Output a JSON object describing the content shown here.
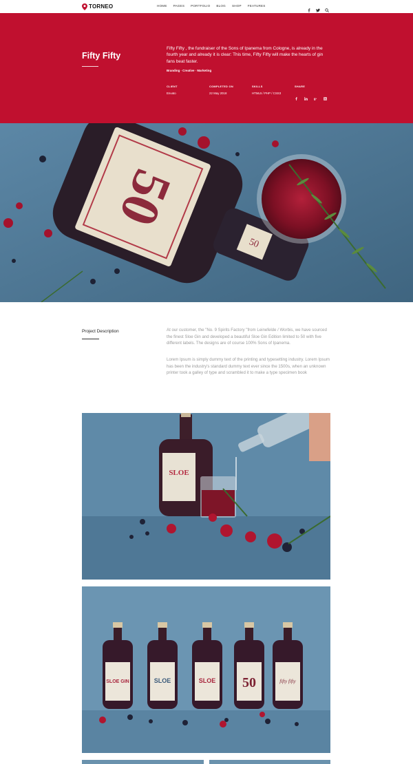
{
  "brand": {
    "name": "TORNEO",
    "accent": "#c0102f"
  },
  "nav": {
    "items": [
      "HOME",
      "PAGES",
      "PORTFOLIO",
      "BLOG",
      "SHOP",
      "FEATURES"
    ]
  },
  "header_social": [
    "facebook-icon",
    "twitter-icon",
    "search-icon"
  ],
  "hero": {
    "title": "Fifty Fifty",
    "description": "Fifty Fifty , the fundraiser of the Sons of Ipanema from Cologne, is already in the fourth year and already it is clear: This time, Fifty Fifty will make the hearts of gin fans beat faster.",
    "tags": "Branding · Creative · Marketing",
    "meta": {
      "client_label": "CLIENT",
      "client_value": "Envato",
      "completed_label": "COMPLETED ON",
      "completed_value": "22 May 2018",
      "skills_label": "SKILLS",
      "skills_value": "HTML5 / PHP / CSS3",
      "share_label": "SHARE"
    },
    "share_icons": [
      "facebook-icon",
      "linkedin-icon",
      "google-plus-icon",
      "instagram-icon"
    ]
  },
  "description": {
    "title": "Project Description",
    "paragraph1": "At our customer, the \"No. 9 Spirits Factory \"from Leinefelde / Worbis, we have sourced the finest Sloe Gin and developed a beautiful Sloe Gin Edition limited to 50 with five different labels. The designs are of course 100% Sons of Ipanema.",
    "paragraph2": "Lorem Ipsum is simply dummy text of the printing and typesetting industry. Lorem Ipsum has been the industry's standard dummy text ever since the 1500s, when an unknown printer took a galley of type and scrambled it to make a type specimen book"
  },
  "bottles": [
    "SLOE GIN",
    "SLOE",
    "SLOE",
    "50",
    "fifty fifty"
  ]
}
